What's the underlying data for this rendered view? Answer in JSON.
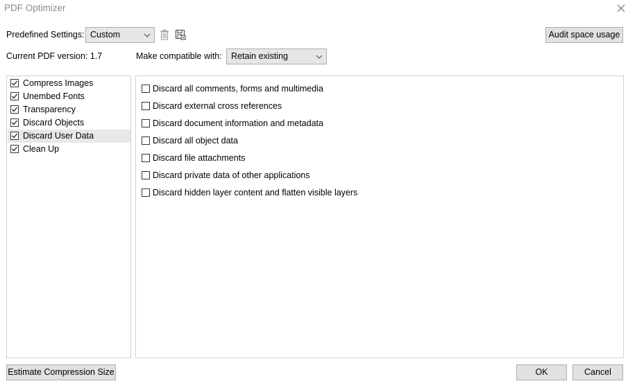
{
  "window": {
    "title": "PDF Optimizer"
  },
  "settings": {
    "predefined_label": "Predefined Settings:",
    "predefined_value": "Custom",
    "version_label": "Current PDF version: 1.7",
    "compat_label": "Make compatible with:",
    "compat_value": "Retain existing",
    "audit_label": "Audit space usage"
  },
  "categories": [
    {
      "label": "Compress Images",
      "checked": true,
      "selected": false
    },
    {
      "label": "Unembed Fonts",
      "checked": true,
      "selected": false
    },
    {
      "label": "Transparency",
      "checked": true,
      "selected": false
    },
    {
      "label": "Discard Objects",
      "checked": true,
      "selected": false
    },
    {
      "label": "Discard User Data",
      "checked": true,
      "selected": true
    },
    {
      "label": "Clean Up",
      "checked": true,
      "selected": false
    }
  ],
  "options": [
    {
      "label": "Discard all comments, forms and multimedia",
      "checked": false
    },
    {
      "label": "Discard external cross references",
      "checked": false
    },
    {
      "label": "Discard document information and metadata",
      "checked": false
    },
    {
      "label": "Discard all object data",
      "checked": false
    },
    {
      "label": "Discard file attachments",
      "checked": false
    },
    {
      "label": "Discard private data of other applications",
      "checked": false
    },
    {
      "label": "Discard hidden layer content and flatten visible layers",
      "checked": false
    }
  ],
  "footer": {
    "estimate_label": "Estimate Compression Size",
    "ok_label": "OK",
    "cancel_label": "Cancel"
  },
  "icons": {
    "close": "close-icon",
    "delete": "trash-icon",
    "save": "save-icon",
    "dropdown": "chevron-down-icon"
  }
}
